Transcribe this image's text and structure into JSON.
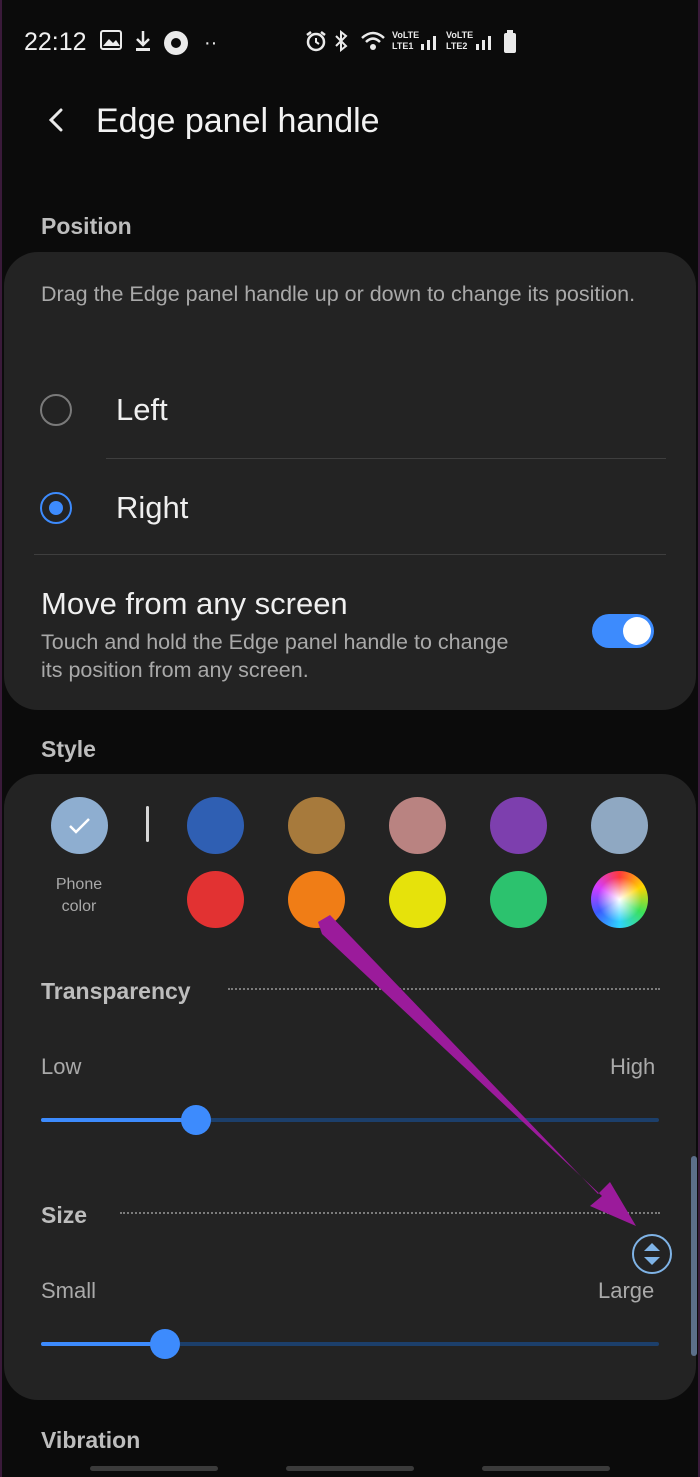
{
  "status_bar": {
    "time": "22:12",
    "icons": [
      "image-icon",
      "download-icon",
      "settings-badge-icon",
      "more-dots-icon",
      "alarm-icon",
      "bluetooth-icon",
      "wifi-icon",
      "signal-icon",
      "battery-icon"
    ],
    "sim1": [
      "VoLTE",
      "LTE1"
    ],
    "sim2": [
      "VoLTE",
      "LTE2"
    ]
  },
  "header": {
    "title": "Edge panel handle"
  },
  "position": {
    "section_label": "Position",
    "description": "Drag the Edge panel handle up or down to change its position.",
    "options": [
      {
        "label": "Left",
        "selected": false
      },
      {
        "label": "Right",
        "selected": true
      }
    ],
    "move_title": "Move from any screen",
    "move_desc": "Touch and hold the Edge panel handle to change its position from any screen.",
    "move_enabled": true
  },
  "style": {
    "section_label": "Style",
    "phone_color_label": [
      "Phone",
      "color"
    ],
    "phone_color": "#8eaed0",
    "swatches_row1": [
      "#2f5fb3",
      "#a77a3c",
      "#b98381",
      "#7d3fae",
      "#8fa8c2"
    ],
    "swatches_row2": [
      "#e23232",
      "#f07d16",
      "#e6e20b",
      "#2cc26e",
      "multicolor"
    ],
    "transparency": {
      "label": "Transparency",
      "low": "Low",
      "high": "High",
      "value": 0.25
    },
    "size": {
      "label": "Size",
      "small": "Small",
      "large": "Large",
      "value": 0.2
    }
  },
  "vibration": {
    "section_label": "Vibration"
  },
  "colors": {
    "accent": "#3d8bfd",
    "card": "#232323",
    "background": "#0b0b0b",
    "annotation_arrow": "#9b1b9b"
  }
}
